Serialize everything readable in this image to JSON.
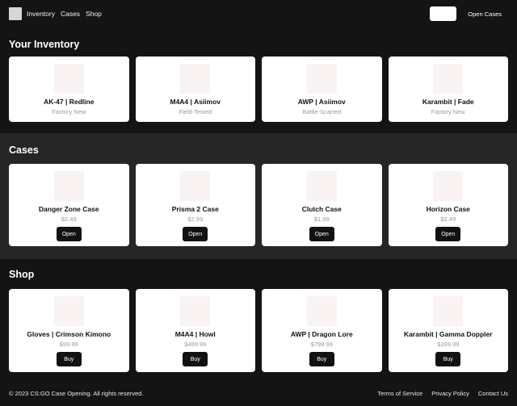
{
  "nav": {
    "links": [
      "Inventory",
      "Cases",
      "Shop"
    ],
    "cta": "Open Cases"
  },
  "inventory": {
    "title": "Your Inventory",
    "items": [
      {
        "name": "AK-47 | Redline",
        "condition": "Factory New"
      },
      {
        "name": "M4A4 | Asiimov",
        "condition": "Field-Tested"
      },
      {
        "name": "AWP | Asiimov",
        "condition": "Battle-Scarred"
      },
      {
        "name": "Karambit | Fade",
        "condition": "Factory New"
      }
    ]
  },
  "cases": {
    "title": "Cases",
    "button": "Open",
    "items": [
      {
        "name": "Danger Zone Case",
        "price": "$2.49"
      },
      {
        "name": "Prisma 2 Case",
        "price": "$2.99"
      },
      {
        "name": "Clutch Case",
        "price": "$1.99"
      },
      {
        "name": "Horizon Case",
        "price": "$2.49"
      }
    ]
  },
  "shop": {
    "title": "Shop",
    "button": "Buy",
    "items": [
      {
        "name": "Gloves | Crimson Kimono",
        "price": "$99.99"
      },
      {
        "name": "M4A4 | Howl",
        "price": "$499.99"
      },
      {
        "name": "AWP | Dragon Lore",
        "price": "$799.99"
      },
      {
        "name": "Karambit | Gamma Doppler",
        "price": "$399.99"
      }
    ]
  },
  "footer": {
    "copyright": "© 2023 CS:GO Case Opening. All rights reserved.",
    "links": [
      "Terms of Service",
      "Privacy Policy",
      "Contact Us"
    ]
  }
}
